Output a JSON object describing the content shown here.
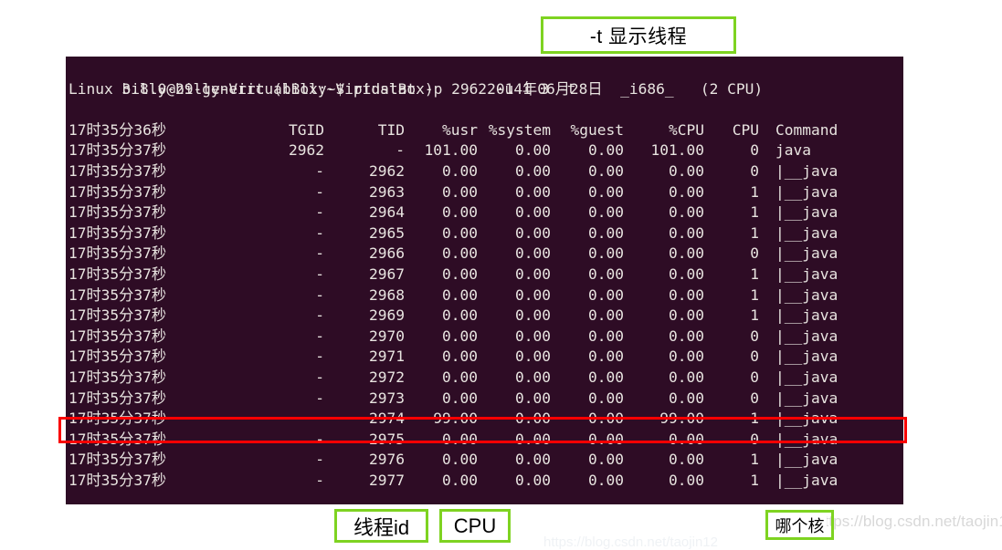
{
  "annotations": {
    "top": "-t 显示线程",
    "thread_id": "线程id",
    "cpu": "CPU",
    "which_core": "哪个核"
  },
  "watermark": {
    "text": "https://blog.csdn.net/taojin12",
    "faint": "https://blog.csdn.net/taojin12"
  },
  "terminal": {
    "prompt_line": "billy@billy-VirtualBox:~$ pidstat -p 2962 -u 1 3 -t",
    "sysinfo": {
      "kernel": "Linux 3.8.0-29-generic",
      "hostname": "(billy-VirtualBox)",
      "date": "2014年06月28日",
      "arch": "_i686_",
      "cpus": "(2 CPU)"
    },
    "header": {
      "time": "17时35分36秒",
      "tgid": "TGID",
      "tid": "TID",
      "usr": "%usr",
      "system": "%system",
      "guest": "%guest",
      "cpu_pct": "%CPU",
      "cpu": "CPU",
      "command": "Command"
    },
    "rows": [
      {
        "time": "17时35分37秒",
        "tgid": "2962",
        "tid": "-",
        "usr": "101.00",
        "system": "0.00",
        "guest": "0.00",
        "cpu_pct": "101.00",
        "cpu": "0",
        "command": "java",
        "highlight": false
      },
      {
        "time": "17时35分37秒",
        "tgid": "-",
        "tid": "2962",
        "usr": "0.00",
        "system": "0.00",
        "guest": "0.00",
        "cpu_pct": "0.00",
        "cpu": "0",
        "command": "|__java",
        "highlight": false
      },
      {
        "time": "17时35分37秒",
        "tgid": "-",
        "tid": "2963",
        "usr": "0.00",
        "system": "0.00",
        "guest": "0.00",
        "cpu_pct": "0.00",
        "cpu": "1",
        "command": "|__java",
        "highlight": false
      },
      {
        "time": "17时35分37秒",
        "tgid": "-",
        "tid": "2964",
        "usr": "0.00",
        "system": "0.00",
        "guest": "0.00",
        "cpu_pct": "0.00",
        "cpu": "1",
        "command": "|__java",
        "highlight": false
      },
      {
        "time": "17时35分37秒",
        "tgid": "-",
        "tid": "2965",
        "usr": "0.00",
        "system": "0.00",
        "guest": "0.00",
        "cpu_pct": "0.00",
        "cpu": "1",
        "command": "|__java",
        "highlight": false
      },
      {
        "time": "17时35分37秒",
        "tgid": "-",
        "tid": "2966",
        "usr": "0.00",
        "system": "0.00",
        "guest": "0.00",
        "cpu_pct": "0.00",
        "cpu": "0",
        "command": "|__java",
        "highlight": false
      },
      {
        "time": "17时35分37秒",
        "tgid": "-",
        "tid": "2967",
        "usr": "0.00",
        "system": "0.00",
        "guest": "0.00",
        "cpu_pct": "0.00",
        "cpu": "1",
        "command": "|__java",
        "highlight": false
      },
      {
        "time": "17时35分37秒",
        "tgid": "-",
        "tid": "2968",
        "usr": "0.00",
        "system": "0.00",
        "guest": "0.00",
        "cpu_pct": "0.00",
        "cpu": "1",
        "command": "|__java",
        "highlight": false
      },
      {
        "time": "17时35分37秒",
        "tgid": "-",
        "tid": "2969",
        "usr": "0.00",
        "system": "0.00",
        "guest": "0.00",
        "cpu_pct": "0.00",
        "cpu": "1",
        "command": "|__java",
        "highlight": false
      },
      {
        "time": "17时35分37秒",
        "tgid": "-",
        "tid": "2970",
        "usr": "0.00",
        "system": "0.00",
        "guest": "0.00",
        "cpu_pct": "0.00",
        "cpu": "0",
        "command": "|__java",
        "highlight": false
      },
      {
        "time": "17时35分37秒",
        "tgid": "-",
        "tid": "2971",
        "usr": "0.00",
        "system": "0.00",
        "guest": "0.00",
        "cpu_pct": "0.00",
        "cpu": "0",
        "command": "|__java",
        "highlight": false
      },
      {
        "time": "17时35分37秒",
        "tgid": "-",
        "tid": "2972",
        "usr": "0.00",
        "system": "0.00",
        "guest": "0.00",
        "cpu_pct": "0.00",
        "cpu": "0",
        "command": "|__java",
        "highlight": false
      },
      {
        "time": "17时35分37秒",
        "tgid": "-",
        "tid": "2973",
        "usr": "0.00",
        "system": "0.00",
        "guest": "0.00",
        "cpu_pct": "0.00",
        "cpu": "0",
        "command": "|__java",
        "highlight": false
      },
      {
        "time": "17时35分37秒",
        "tgid": "-",
        "tid": "2974",
        "usr": "99.00",
        "system": "0.00",
        "guest": "0.00",
        "cpu_pct": "99.00",
        "cpu": "1",
        "command": "|__java",
        "highlight": true
      },
      {
        "time": "17时35分37秒",
        "tgid": "-",
        "tid": "2975",
        "usr": "0.00",
        "system": "0.00",
        "guest": "0.00",
        "cpu_pct": "0.00",
        "cpu": "0",
        "command": "|__java",
        "highlight": false
      },
      {
        "time": "17时35分37秒",
        "tgid": "-",
        "tid": "2976",
        "usr": "0.00",
        "system": "0.00",
        "guest": "0.00",
        "cpu_pct": "0.00",
        "cpu": "1",
        "command": "|__java",
        "highlight": false
      },
      {
        "time": "17时35分37秒",
        "tgid": "-",
        "tid": "2977",
        "usr": "0.00",
        "system": "0.00",
        "guest": "0.00",
        "cpu_pct": "0.00",
        "cpu": "1",
        "command": "|__java",
        "highlight": false
      }
    ]
  },
  "colors": {
    "terminal_bg": "#2e0c25",
    "terminal_fg": "#e8e4e0",
    "annotation_border": "#7ed321",
    "highlight_border": "#f90000",
    "watermark": "#d8d8d8"
  }
}
